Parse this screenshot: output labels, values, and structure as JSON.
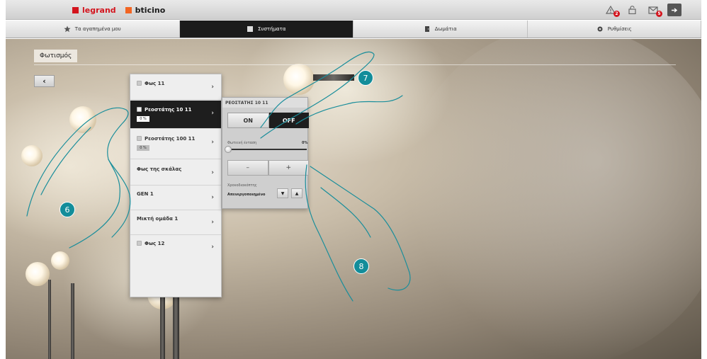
{
  "brand": {
    "legrand": "legrand",
    "bticino": "bticino",
    "accent": "#d3141d"
  },
  "topbar_icons": [
    {
      "name": "alarm-warning-icon",
      "badge": "2"
    },
    {
      "name": "lock-icon",
      "badge": ""
    },
    {
      "name": "mail-icon",
      "badge": "5"
    },
    {
      "name": "logout-icon",
      "badge": ""
    }
  ],
  "tabs": [
    {
      "label": "Τα αγαπημένα μου",
      "icon": "star-icon",
      "active": false
    },
    {
      "label": "Συστήματα",
      "icon": "systems-icon",
      "active": true
    },
    {
      "label": "Δωμάτια",
      "icon": "rooms-icon",
      "active": false
    },
    {
      "label": "Ρυθμίσεις",
      "icon": "settings-icon",
      "active": false
    }
  ],
  "page": {
    "title": "Φωτισμός",
    "back_label": "‹"
  },
  "devices": [
    {
      "label": "Φως 11",
      "has_checkbox": true,
      "percent": "",
      "selected": false
    },
    {
      "label": "Ρεοστάτης 10 11",
      "has_checkbox": true,
      "percent": "0 %",
      "selected": true
    },
    {
      "label": "Ρεοστάτης 100 11",
      "has_checkbox": true,
      "percent": "0 %",
      "selected": false
    },
    {
      "label": "Φως της σκάλας",
      "has_checkbox": false,
      "percent": "",
      "selected": false
    },
    {
      "label": "GEN 1",
      "has_checkbox": false,
      "percent": "",
      "selected": false
    },
    {
      "label": "Μικτή ομάδα 1",
      "has_checkbox": false,
      "percent": "",
      "selected": false
    },
    {
      "label": "Φως 12",
      "has_checkbox": true,
      "percent": "",
      "selected": false
    }
  ],
  "control": {
    "header": "ΡΕΟΣΤΑΤΗΣ 10 11",
    "on_label": "ON",
    "off_label": "OFF",
    "intensity_label": "Φωτεινή ένταση",
    "intensity_value": "0%",
    "minus_label": "–",
    "plus_label": "+",
    "timer_label": "Χρονοδιακόπτης",
    "timer_state": "Απενεργοποιημένο",
    "down_label": "▼",
    "up_label": "▲"
  },
  "steps": [
    "6",
    "7",
    "8"
  ],
  "step_color": "#138d9a"
}
